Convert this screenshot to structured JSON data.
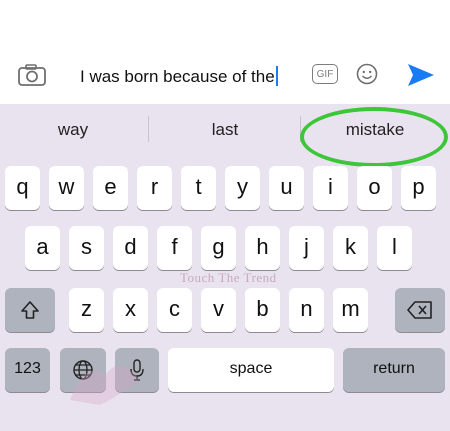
{
  "compose": {
    "text": "I was born because of the",
    "gif_label": "GIF"
  },
  "suggestions": [
    "way",
    "last",
    "mistake"
  ],
  "rows": {
    "row1": [
      "q",
      "w",
      "e",
      "r",
      "t",
      "y",
      "u",
      "i",
      "o",
      "p"
    ],
    "row2": [
      "a",
      "s",
      "d",
      "f",
      "g",
      "h",
      "j",
      "k",
      "l"
    ],
    "row3": [
      "z",
      "x",
      "c",
      "v",
      "b",
      "n",
      "m"
    ]
  },
  "bottom": {
    "numbers_label": "123",
    "space_label": "space",
    "return_label": "return"
  },
  "watermark": "Touch The Trend",
  "colors": {
    "highlight_ring": "#3ec63a",
    "send": "#1a7cf5",
    "keyboard_bg": "#e9e3ef"
  },
  "icons": [
    "camera-icon",
    "gif-icon",
    "emoji-icon",
    "send-icon",
    "shift-icon",
    "backspace-icon",
    "globe-icon",
    "microphone-icon"
  ]
}
